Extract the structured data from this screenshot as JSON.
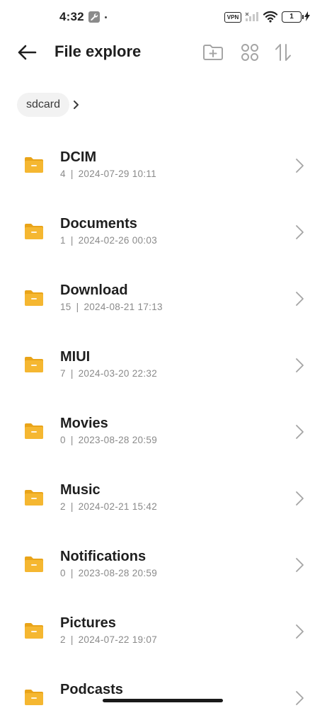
{
  "status_bar": {
    "time": "4:32",
    "vpn_label": "VPN",
    "battery_level": "1"
  },
  "header": {
    "title": "File explore",
    "back_icon": "arrow-left-icon",
    "actions": [
      "new-folder-icon",
      "grid-view-icon",
      "sort-icon"
    ]
  },
  "breadcrumb": {
    "items": [
      "sdcard"
    ]
  },
  "folders": [
    {
      "name": "DCIM",
      "count": "4",
      "date": "2024-07-29 10:11"
    },
    {
      "name": "Documents",
      "count": "1",
      "date": "2024-02-26 00:03"
    },
    {
      "name": "Download",
      "count": "15",
      "date": "2024-08-21 17:13"
    },
    {
      "name": "MIUI",
      "count": "7",
      "date": "2024-03-20 22:32"
    },
    {
      "name": "Movies",
      "count": "0",
      "date": "2023-08-28 20:59"
    },
    {
      "name": "Music",
      "count": "2",
      "date": "2024-02-21 15:42"
    },
    {
      "name": "Notifications",
      "count": "0",
      "date": "2023-08-28 20:59"
    },
    {
      "name": "Pictures",
      "count": "2",
      "date": "2024-07-22 19:07"
    },
    {
      "name": "Podcasts",
      "count": "",
      "date": ""
    }
  ],
  "colors": {
    "folder": "#f5b731",
    "folder_dark": "#e9a419",
    "text_primary": "#1f1f1f",
    "text_secondary": "#8a8a8a",
    "icon_gray": "#a5a5a5"
  },
  "meta_separator": "|"
}
